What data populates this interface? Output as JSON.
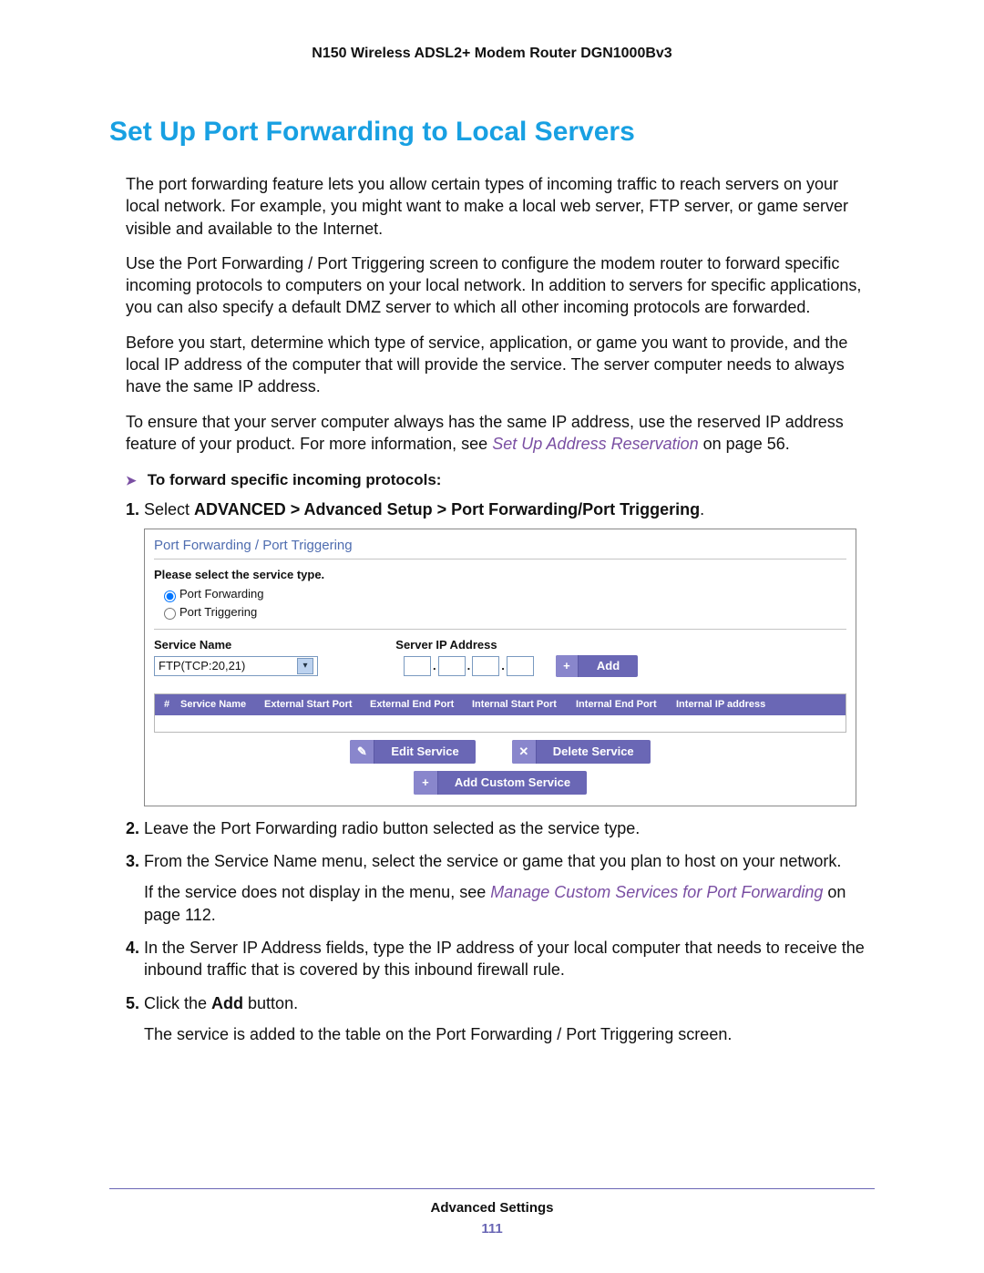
{
  "header": {
    "product": "N150 Wireless ADSL2+ Modem Router DGN1000Bv3"
  },
  "section": {
    "title": "Set Up Port Forwarding to Local Servers"
  },
  "paras": {
    "p1": "The port forwarding feature lets you allow certain types of incoming traffic to reach servers on your local network. For example, you might want to make a local web server, FTP server, or game server visible and available to the Internet.",
    "p2": "Use the Port Forwarding / Port Triggering screen to configure the modem router to forward specific incoming protocols to computers on your local network. In addition to servers for specific applications, you can also specify a default DMZ server to which all other incoming protocols are forwarded.",
    "p3": "Before you start, determine which type of service, application, or game you want to provide, and the local IP address of the computer that will provide the service. The server computer needs to always have the same IP address.",
    "p4_prefix": "To ensure that your server computer always has the same IP address, use the reserved IP address feature of your product. For more information, see ",
    "p4_link": "Set Up Address Reservation",
    "p4_suffix": " on page 56."
  },
  "procedure": {
    "heading": "To forward specific incoming protocols:",
    "steps": {
      "s1_prefix": "Select ",
      "s1_bold": "ADVANCED > Advanced Setup > Port Forwarding/Port Triggering",
      "s1_suffix": ".",
      "s2": "Leave the Port Forwarding radio button selected as the service type.",
      "s3": "From the Service Name menu, select the service or game that you plan to host on your network.",
      "s3_sub_prefix": "If the service does not display in the menu, see ",
      "s3_sub_link": "Manage Custom Services for Port Forwarding",
      "s3_sub_suffix": " on page 112.",
      "s4": "In the Server IP Address fields, type the IP address of your local computer that needs to receive the inbound traffic that is covered by this inbound firewall rule.",
      "s5_prefix": "Click the ",
      "s5_bold": "Add",
      "s5_suffix": " button.",
      "s5_sub": "The service is added to the table on the Port Forwarding / Port Triggering screen."
    }
  },
  "panel": {
    "title": "Port Forwarding / Port Triggering",
    "select_prompt": "Please select the service type.",
    "radio1": "Port Forwarding",
    "radio2": "Port Triggering",
    "service_name_label": "Service Name",
    "server_ip_label": "Server IP Address",
    "service_name_value": "FTP(TCP:20,21)",
    "add_btn": "Add",
    "columns": {
      "hash": "#",
      "sn": "Service Name",
      "esp": "External Start Port",
      "eep": "External End Port",
      "isp": "Internal Start Port",
      "iep": "Internal End Port",
      "iip": "Internal IP address"
    },
    "edit_btn": "Edit Service",
    "delete_btn": "Delete Service",
    "custom_btn": "Add Custom Service"
  },
  "footer": {
    "section": "Advanced Settings",
    "page": "111"
  }
}
